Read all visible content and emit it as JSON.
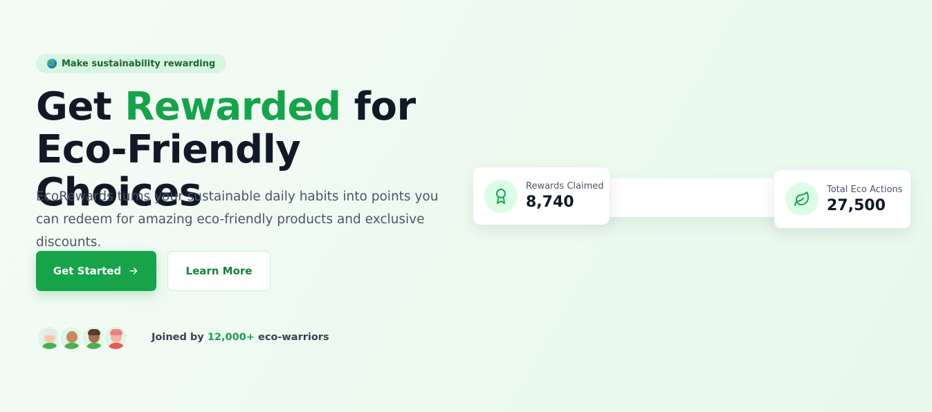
{
  "badge": {
    "icon": "globe-icon",
    "text": "Make sustainability rewarding"
  },
  "hero": {
    "title_part1": "Get",
    "title_accent": "Rewarded",
    "title_part2": "for",
    "title_line2": "Eco-Friendly Choices",
    "description": "EcoRewards turns your sustainable daily habits into points you can redeem for amazing eco-friendly products and exclusive discounts.",
    "accent_color": "#16a34a"
  },
  "buttons": {
    "primary_label": "Get Started",
    "primary_icon": "arrow-right-icon",
    "secondary_label": "Learn More"
  },
  "social_proof": {
    "prefix": "Joined by",
    "count": "12,000+",
    "suffix": "eco-warriors"
  },
  "stats": [
    {
      "label": "Rewards Claimed",
      "value": "8,740",
      "icon": "award-icon"
    },
    {
      "label": "Total Eco Actions",
      "value": "27,500",
      "icon": "leaf-icon"
    }
  ],
  "hidden_card": {
    "text": "rd"
  }
}
